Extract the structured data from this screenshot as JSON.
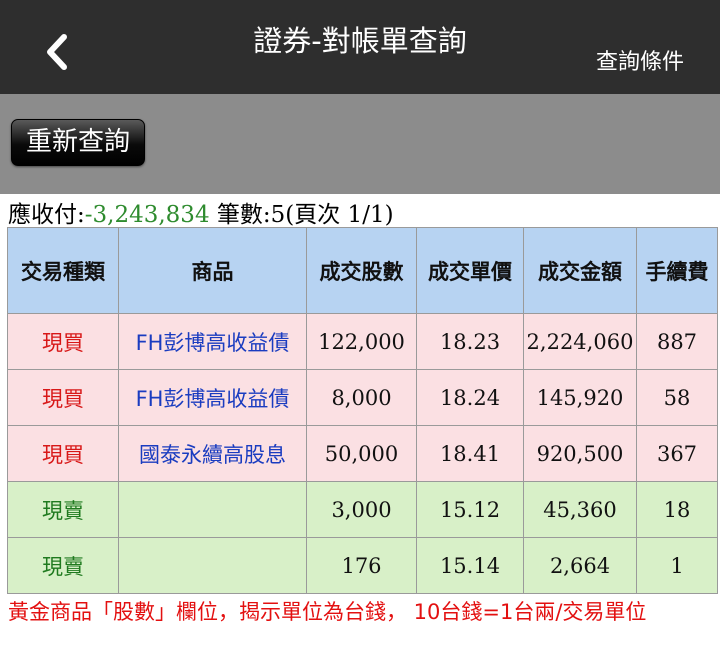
{
  "nav": {
    "back_icon": "chevron-left-icon",
    "title": "證券-對帳單查詢",
    "query_conditions": "查詢條件"
  },
  "toolbar": {
    "requery_label": "重新查詢"
  },
  "summary": {
    "receivable_label": "應收付:",
    "receivable_value": "-3,243,834",
    "count_label": "筆數:5(頁次 1/1)"
  },
  "table": {
    "headers": [
      "交易種類",
      "商品",
      "成交股數",
      "成交單價",
      "成交金額",
      "手續費"
    ],
    "rows": [
      {
        "type": "現買",
        "product": "FH彭博高收益債",
        "shares": "122,000",
        "price": "18.23",
        "amount": "2,224,060",
        "fee": "887"
      },
      {
        "type": "現買",
        "product": "FH彭博高收益債",
        "shares": "8,000",
        "price": "18.24",
        "amount": "145,920",
        "fee": "58"
      },
      {
        "type": "現買",
        "product": "國泰永續高股息",
        "shares": "50,000",
        "price": "18.41",
        "amount": "920,500",
        "fee": "367"
      },
      {
        "type": "現賣",
        "product": "",
        "shares": "3,000",
        "price": "15.12",
        "amount": "45,360",
        "fee": "18"
      },
      {
        "type": "現賣",
        "product": "",
        "shares": "176",
        "price": "15.14",
        "amount": "2,664",
        "fee": "1"
      }
    ]
  },
  "note": "黃金商品「股數」欄位，揭示單位為台錢， 10台錢=1台兩/交易單位",
  "colors": {
    "nav_bg": "#2e2e2e",
    "header_bg": "#b7d3f2",
    "buy_row": "#fbe0e3",
    "sell_row": "#d8f0c8",
    "buy_text": "#d81818",
    "sell_text": "#1f7a1f",
    "product_text": "#1a3cc0"
  }
}
